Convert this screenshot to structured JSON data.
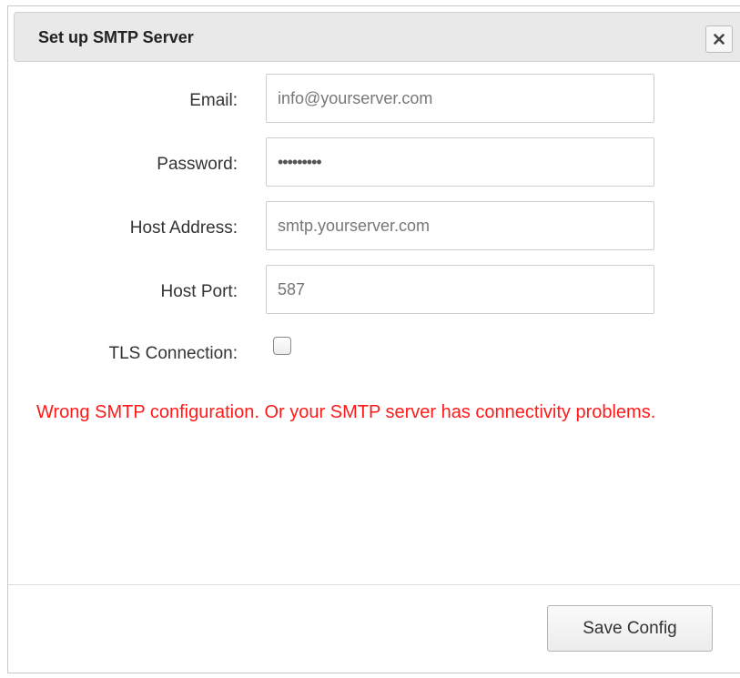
{
  "dialog": {
    "title": "Set up SMTP Server",
    "close_icon": "close-x-icon"
  },
  "form": {
    "email": {
      "label": "Email:",
      "value": "info@yourserver.com"
    },
    "password": {
      "label": "Password:",
      "value": "•••••••••"
    },
    "host_address": {
      "label": "Host Address:",
      "value": "smtp.yourserver.com"
    },
    "host_port": {
      "label": "Host Port:",
      "value": "587"
    },
    "tls": {
      "label": "TLS Connection:",
      "checked": false
    }
  },
  "error_message": "Wrong SMTP configuration. Or your SMTP server has connectivity problems.",
  "footer": {
    "save_label": "Save Config"
  },
  "colors": {
    "error": "#ff1a1a",
    "titlebar_bg": "#e9e9e9"
  }
}
